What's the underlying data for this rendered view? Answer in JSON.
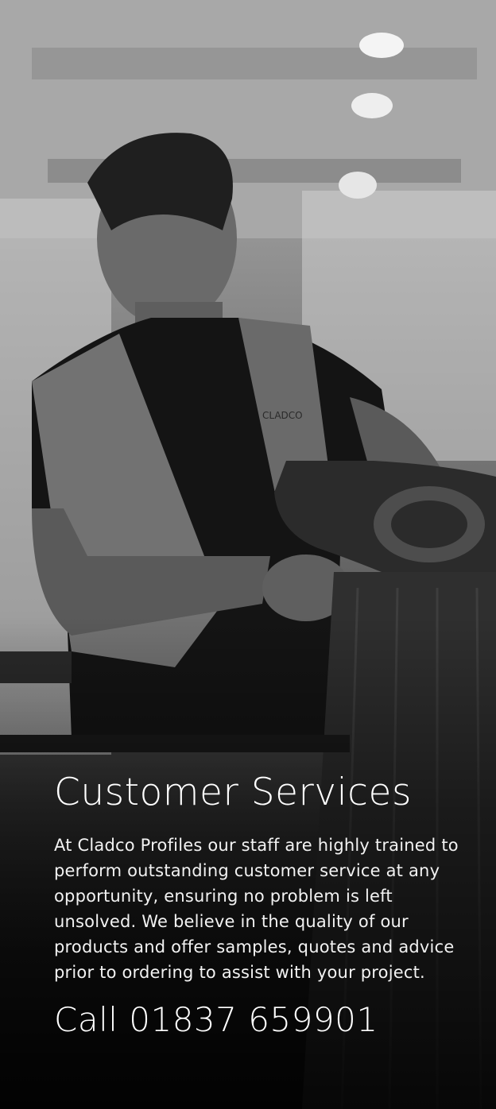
{
  "panel": {
    "heading": "Customer Services",
    "body": "At Cladco Profiles our staff are highly trained to perform outstanding customer service at any opportunity, ensuring no problem is left unsolved. We believe in the quality of our products and offer samples, quotes and advice prior to ordering to assist with your project.",
    "call": "Call 01837 659901"
  },
  "photo": {
    "subject": "worker-in-hi-vis-vest-with-power-tool",
    "vest_logo": "CLADCO"
  },
  "colors": {
    "text": "#ffffff",
    "overlay": "#000000"
  }
}
